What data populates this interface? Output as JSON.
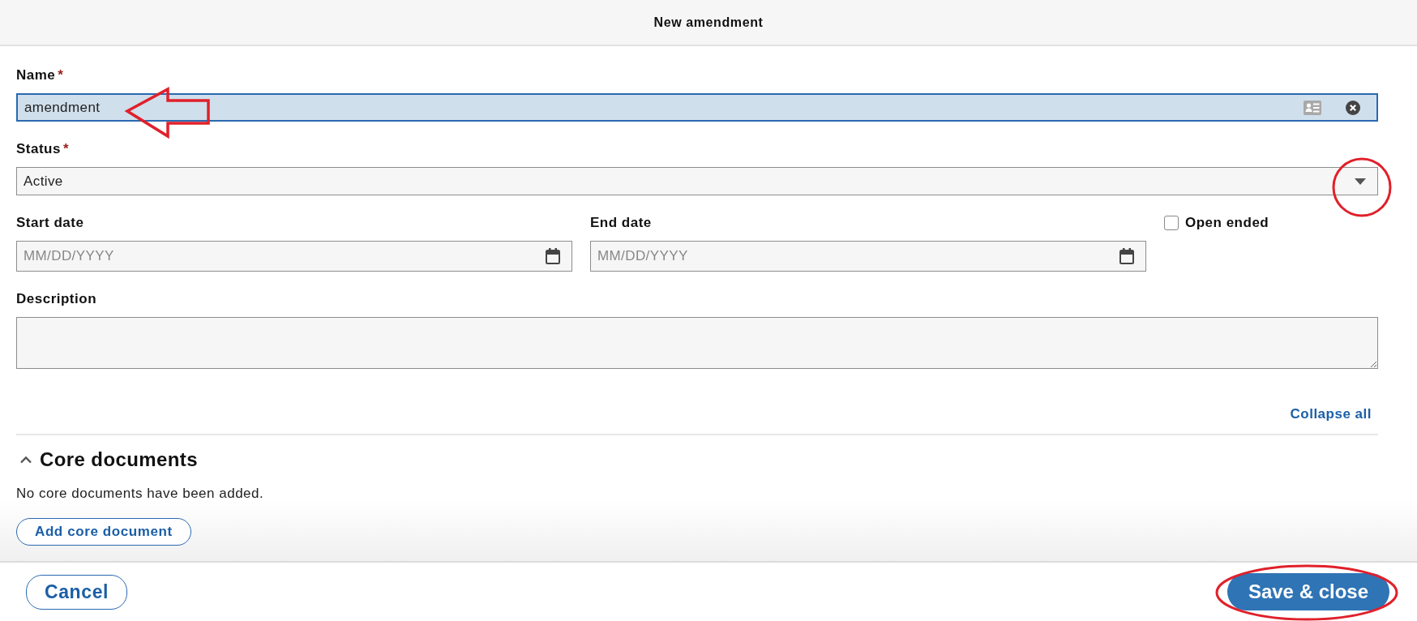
{
  "dialog": {
    "title": "New amendment"
  },
  "name_field": {
    "label": "Name",
    "required_mark": "*",
    "value": "amendment",
    "focused": true
  },
  "status_field": {
    "label": "Status",
    "required_mark": "*",
    "value": "Active"
  },
  "start_date": {
    "label": "Start date",
    "placeholder": "MM/DD/YYYY"
  },
  "end_date": {
    "label": "End date",
    "placeholder": "MM/DD/YYYY"
  },
  "open_ended": {
    "label": "Open ended",
    "checked": false
  },
  "description": {
    "label": "Description"
  },
  "collapse_all": "Collapse all",
  "sections": [
    {
      "title": "Core documents",
      "expanded": true,
      "empty_text": "No core documents have been added.",
      "add_button": "Add core document"
    }
  ],
  "footer": {
    "cancel": "Cancel",
    "save": "Save & close"
  }
}
